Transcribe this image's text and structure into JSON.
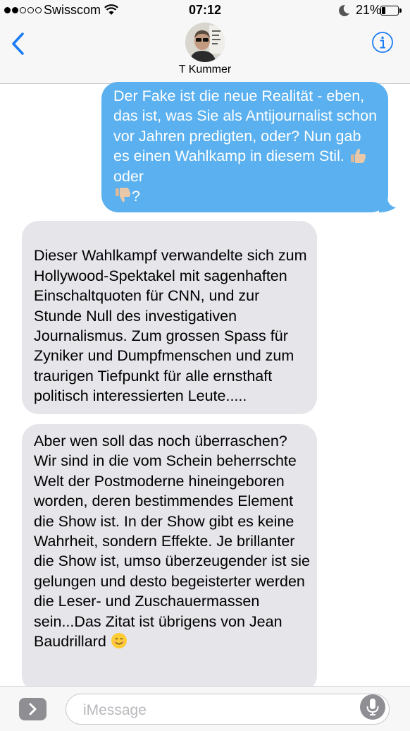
{
  "status_bar": {
    "carrier": "Swisscom",
    "time": "07:12",
    "battery": "21%",
    "battery_level": 0.21,
    "signal_bars_filled": 2,
    "signal_bars_total": 5,
    "icons": [
      "wifi-icon",
      "moon-icon",
      "battery-icon"
    ]
  },
  "header": {
    "contact_name": "T Kummer",
    "icons": [
      "back-chevron-icon",
      "avatar",
      "info-icon"
    ],
    "accent_color": "#1a7cf5"
  },
  "messages": [
    {
      "direction": "outgoing",
      "text": "Der Fake ist die neue Realität - eben, das ist, was Sie als Antijournalist schon vor Jahren predigten, oder? Nun gab es einen Wahlkamp in diesem Stil.",
      "emoji_1": "thumbs-up-icon",
      "text_after": " oder",
      "emoji_2": "thumbs-down-icon",
      "text_end": "?",
      "color": "#5bb1f0"
    },
    {
      "direction": "incoming",
      "text": "Dieser Wahlkampf verwandelte sich zum Hollywood-Spektakel mit sagenhaften Einschaltquoten für CNN, und  zur Stunde Null des investigativen Journalismus. Zum grossen Spass für Zyniker und Dumpfmenschen und zum traurigen Tiefpunkt für alle ernsthaft politisch interessierten Leute.....",
      "color": "#e5e5ea"
    },
    {
      "direction": "incoming",
      "text": "Aber wen soll das noch überraschen?  Wir sind in die vom Schein beherrschte Welt der Postmoderne hineingeboren worden, deren bestimmendes Element die Show ist. In der Show gibt es keine Wahrheit, sondern Effekte. Je brillanter die Show ist, umso überzeugender ist sie gelungen und desto begeisterter werden die Leser- und Zuschauermassen sein...Das Zitat ist übrigens von Jean Baudrillard",
      "emoji": "smiling-face-icon",
      "color": "#e5e5ea"
    }
  ],
  "input_bar": {
    "placeholder": "iMessage",
    "value": "",
    "icons": [
      "expand-chevron-icon",
      "microphone-icon"
    ]
  }
}
